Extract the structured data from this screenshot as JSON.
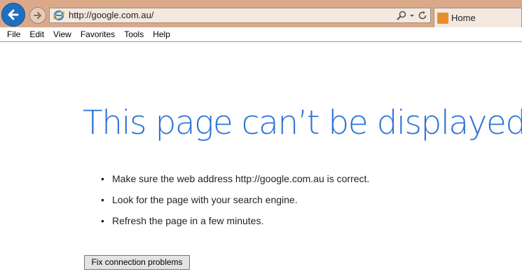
{
  "browser": {
    "address": "http://google.com.au/",
    "tab_title": "Home"
  },
  "menu": [
    "File",
    "Edit",
    "View",
    "Favorites",
    "Tools",
    "Help"
  ],
  "error": {
    "title": "This page can’t be displayed",
    "tips": [
      "Make sure the web address http://google.com.au is correct.",
      "Look for the page with your search engine.",
      "Refresh the page in a few minutes."
    ],
    "fix_button": "Fix connection problems"
  },
  "colors": {
    "chrome": "#d9a98a",
    "back_button": "#1e6fc0",
    "title": "#2e74d4"
  },
  "icons": [
    "back-arrow-icon",
    "forward-arrow-icon",
    "ie-logo-icon",
    "search-icon",
    "dropdown-icon",
    "refresh-icon",
    "tab-favicon-icon"
  ]
}
